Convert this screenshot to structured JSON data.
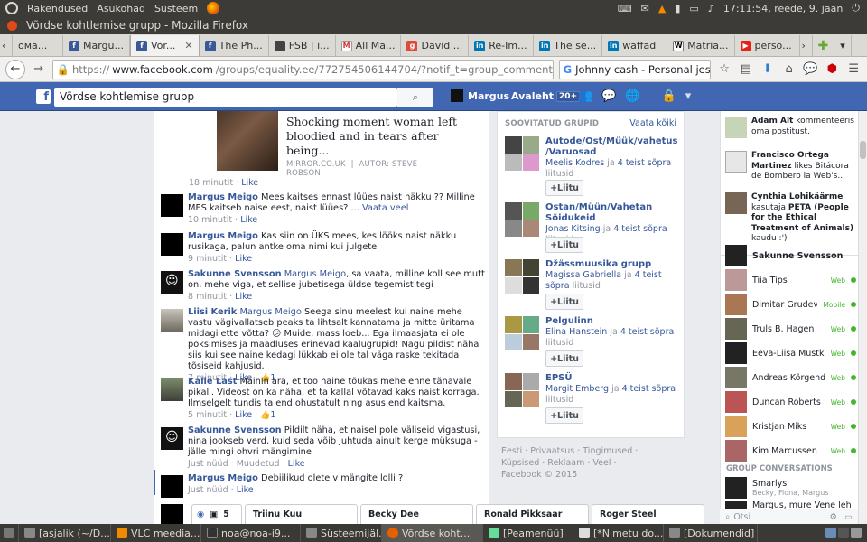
{
  "topbar": {
    "menu": [
      "Rakendused",
      "Asukohad",
      "Süsteem"
    ],
    "clock": "17:11:54, reede, 9. jaan"
  },
  "window": {
    "title": "Võrdse kohtlemise grupp - Mozilla Firefox"
  },
  "tabs": [
    {
      "label": "ома...",
      "icon": "fav"
    },
    {
      "label": "Margu...",
      "icon": "fb"
    },
    {
      "label": "Võr...",
      "icon": "fb",
      "active": true
    },
    {
      "label": "The Ph...",
      "icon": "fb"
    },
    {
      "label": "FSB | i...",
      "icon": "fsb"
    },
    {
      "label": "All Ma...",
      "icon": "gm"
    },
    {
      "label": "David ...",
      "icon": "g"
    },
    {
      "label": "Re-Im...",
      "icon": "li"
    },
    {
      "label": "The se...",
      "icon": "li"
    },
    {
      "label": "waffad",
      "icon": "li"
    },
    {
      "label": "Matria...",
      "icon": "w"
    },
    {
      "label": "perso...",
      "icon": "yt"
    }
  ],
  "urlbar": {
    "protocol": "https://",
    "domain": "www.facebook.com",
    "path": "/groups/equality.ee/772754506144704/?notif_t=group_comment_reply",
    "search": "Johnny cash - Personal jesus"
  },
  "fb": {
    "search_value": "Võrdse kohtlemise grupp",
    "user": "Margus",
    "home": "Avaleht",
    "home_badge": "20+"
  },
  "attachment": {
    "headline": "Shocking moment woman left bloodied and in tears after being...",
    "source": "MIRROR.CO.UK",
    "author": "AUTOR: STEVE ROBSON",
    "time": "18 minutit",
    "like": "Like"
  },
  "comments": [
    {
      "name": "Margus Meigo",
      "mention": "",
      "text": "Mees kaitses ennast lüües naist näkku ?? Milline MES kaitseb naise eest, naist lüües? ...",
      "more": "Vaata veel",
      "time": "10 minutit",
      "like": "Like",
      "likes": ""
    },
    {
      "name": "Margus Meigo",
      "mention": "",
      "text": "Kas siin on ÜKS mees, kes lööks naist näkku rusikaga, palun antke oma nimi kui julgete",
      "more": "",
      "time": "9 minutit",
      "like": "Like",
      "likes": ""
    },
    {
      "name": "Sakunne Svensson",
      "mention": "Margus Meigo",
      "text": ", sa vaata, milline koll see mutt on, mehe viga, et sellise jubetisega üldse tegemist tegi",
      "more": "",
      "time": "8 minutit",
      "like": "Like",
      "likes": ""
    },
    {
      "name": "Liisi Kerik",
      "mention": "Margus Meigo",
      "text": "Seega sinu meelest kui naine mehe vastu vägivallatseb peaks ta lihtsalt kannatama ja mitte üritama midagi ette võtta? 😕 Muide, mass loeb... Ega ilmaasjata ei ole poksimises ja maadluses erinevad kaalugrupid! Nagu pildist näha siis kui see naine kedagi lükkab ei ole tal väga raske tekitada tõsiseid kahjusid.",
      "more": "",
      "time": "7 minutit",
      "like": "Like",
      "likes": "1"
    },
    {
      "name": "Kalle Last",
      "mention": "",
      "text": "Mainin ära, et too naine tõukas mehe enne tänavale pikali. Videost on ka näha, et ta kallal võtavad kaks naist korraga. Ilmselgelt tundis ta end ohustatult ning asus end kaitsma.",
      "more": "",
      "time": "5 minutit",
      "like": "Like",
      "likes": "1"
    },
    {
      "name": "Sakunne Svensson",
      "mention": "",
      "text": "Pildilt näha, et naisel pole väliseid vigastusi, nina jookseb verd, kuid seda võib juhtuda ainult kerge müksuga - jälle mingi ohvri mängimine",
      "more": "",
      "time": "Just nüüd",
      "edited": "Muudetud",
      "like": "Like",
      "likes": ""
    },
    {
      "name": "Margus Meigo",
      "mention": "",
      "text": "Debiilikud olete v mängite lolli ?",
      "more": "",
      "time": "Just nüüd",
      "like": "Like",
      "likes": ""
    }
  ],
  "groups": {
    "heading": "SOOVITATUD GRUPID",
    "see_all": "Vaata kõiki",
    "join": "Liitu",
    "items": [
      {
        "title": "Autode/Ost/Müük/vahetus /Varuosad",
        "person": "Meelis Kodres",
        "friends": "4 teist sõpra",
        "joined": "liitusid"
      },
      {
        "title": "Ostan/Müün/Vahetan Sõidukeid",
        "person": "Jonas Kitsing",
        "friends": "4 teist sõpra",
        "joined": "liitusid"
      },
      {
        "title": "Džässmuusika grupp",
        "person": "Magissa Gabriella",
        "friends": "4 teist sõpra",
        "joined": "liitusid"
      },
      {
        "title": "Pelgulinn",
        "person": "Elina Hanstein",
        "friends": "4 teist sõpra",
        "joined": "liitusid"
      },
      {
        "title": "EPSÜ",
        "person": "Margit Emberg",
        "friends": "4 teist sõpra",
        "joined": "liitusid"
      }
    ]
  },
  "footer": {
    "links": "Eesti · Privaatsus · Tingimused · Küpsised · Reklaam · Veel ·",
    "copyright": "Facebook © 2015"
  },
  "ticker": [
    {
      "name": "Adam Alt",
      "text": "kommenteeris oma postitust."
    },
    {
      "name": "Francisco Ortega Martinez",
      "text": "likes Bitácora de Bombero la Web's..."
    },
    {
      "name": "Cynthia Lohikäärme",
      "text": "kasutaja",
      "bold2": "PETA (People for the Ethical Treatment of Animals)",
      "text2": "kaudu :')"
    }
  ],
  "chat": {
    "people": [
      {
        "name": "Sakunne Svensson",
        "status": ""
      },
      {
        "name": "Tiia Tips",
        "status": "Web"
      },
      {
        "name": "Dimitar Grudev",
        "status": "Mobile"
      },
      {
        "name": "Truls B. Hagen",
        "status": "Web"
      },
      {
        "name": "Eeva-Liisa Mustkivi",
        "status": "Web"
      },
      {
        "name": "Andreas Kõrgend",
        "status": "Web"
      },
      {
        "name": "Duncan Roberts",
        "status": "Web"
      },
      {
        "name": "Kristjan Miks",
        "status": "Web"
      },
      {
        "name": "Kim Marcussen",
        "status": "Web"
      }
    ],
    "group_heading": "GROUP CONVERSATIONS",
    "groups": [
      {
        "name": "Smarlys",
        "members": "Becky, Fiona, Margus"
      },
      {
        "name": "Margus, mure Vene leh"
      }
    ],
    "search_placeholder": "Otsi"
  },
  "chat_tabs": {
    "count": "5",
    "tabs": [
      "Triinu Kuu",
      "Becky Dee",
      "Ronald Pikksaar",
      "Roger Steel"
    ]
  },
  "taskbar": [
    {
      "label": "[asjalik (~/D...",
      "color": "#888"
    },
    {
      "label": "VLC meedia...",
      "color": "#f08a00"
    },
    {
      "label": "noa@noa-i9...",
      "color": "#333"
    },
    {
      "label": "Süsteemijäl...",
      "color": "#888"
    },
    {
      "label": "Võrdse koht...",
      "color": "#e66000",
      "active": true
    },
    {
      "label": "[Peamenüü]",
      "color": "#6d9"
    },
    {
      "label": "[*Nimetu do...",
      "color": "#ddd"
    },
    {
      "label": "[Dokumendid]",
      "color": "#888"
    }
  ]
}
